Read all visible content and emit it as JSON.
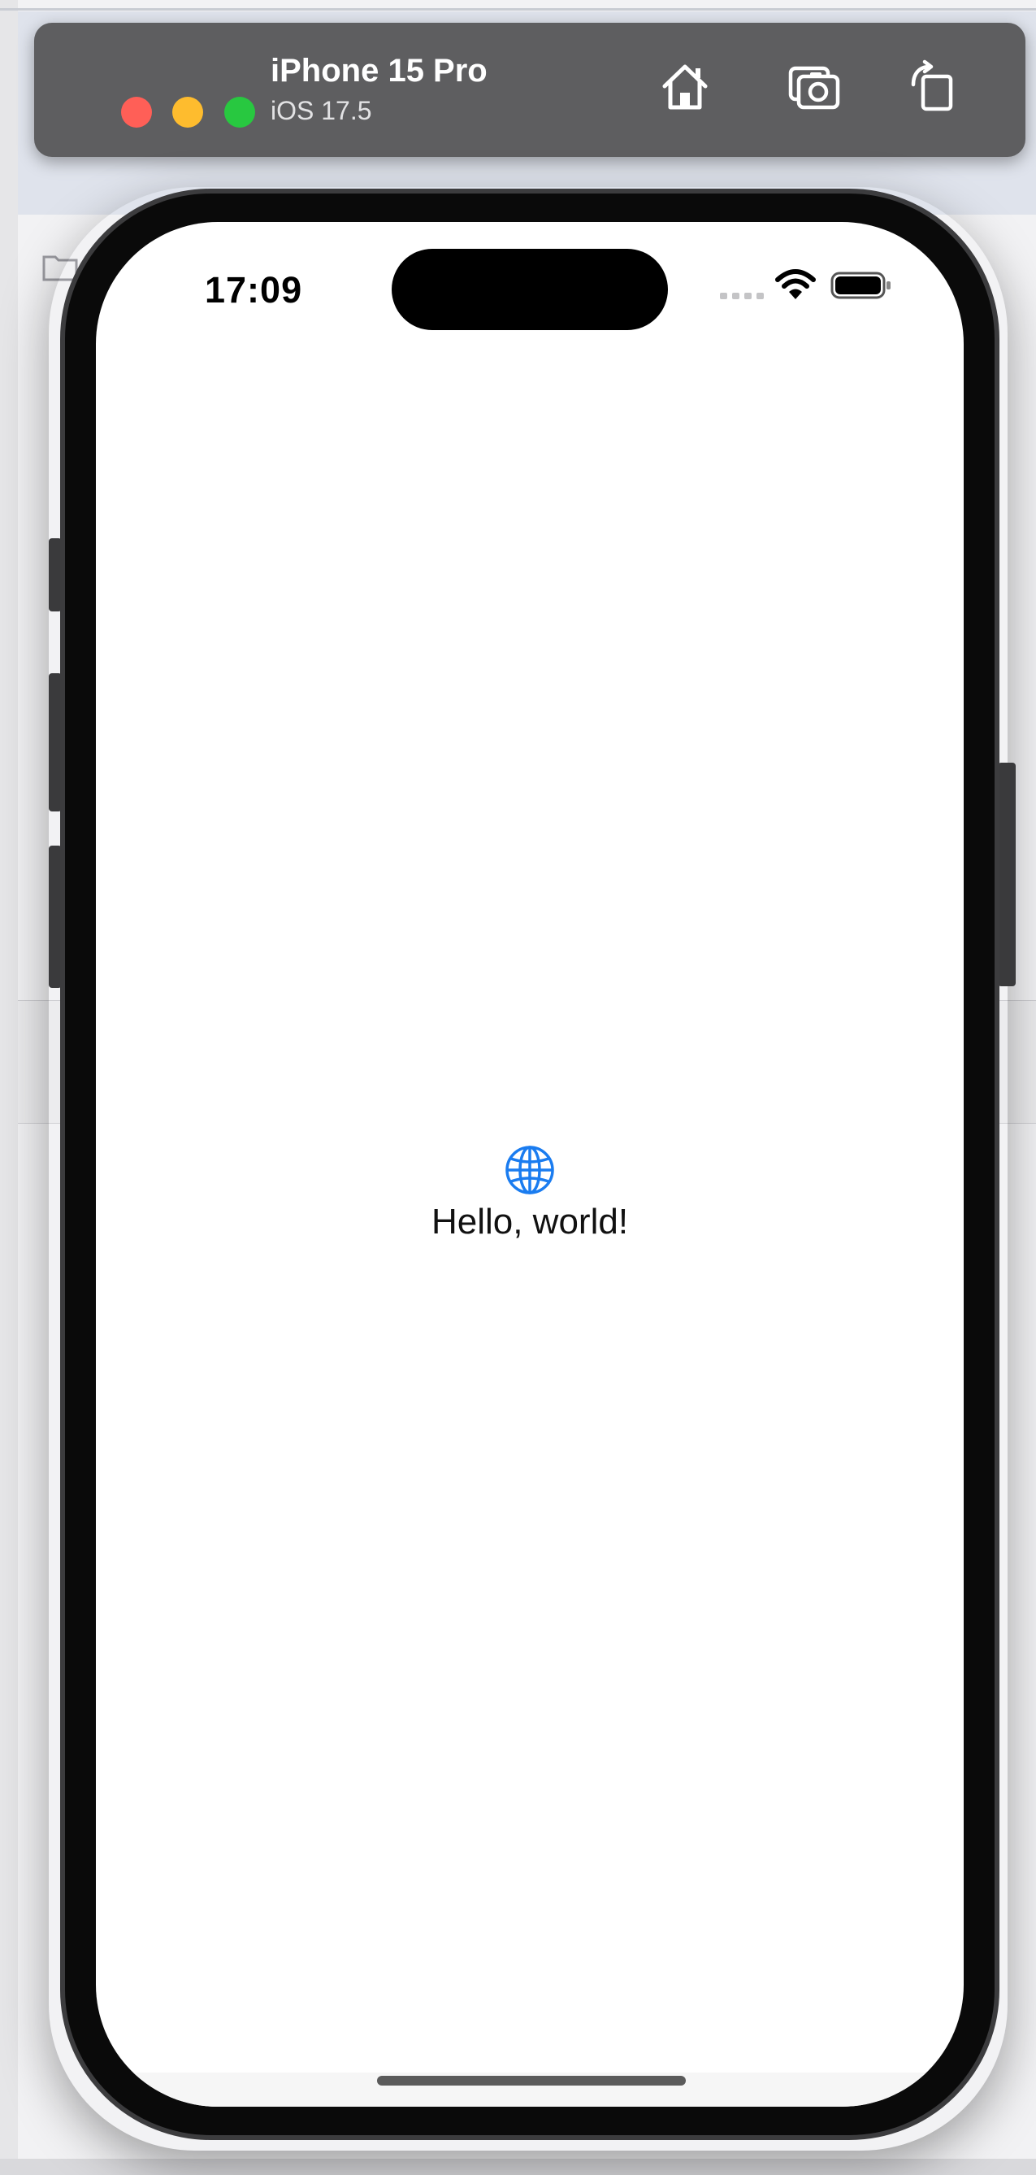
{
  "simulator": {
    "device_name": "iPhone 15 Pro",
    "os_version": "iOS 17.5",
    "icons": [
      "home-icon",
      "screenshot-icon",
      "rotate-icon"
    ]
  },
  "phone": {
    "status_time": "17:09",
    "icons": [
      "cellular-signal-icon",
      "wifi-icon",
      "battery-icon"
    ]
  },
  "content": {
    "icon": "globe-icon",
    "accent_color": "#1a7cf0",
    "greeting": "Hello, world!"
  }
}
